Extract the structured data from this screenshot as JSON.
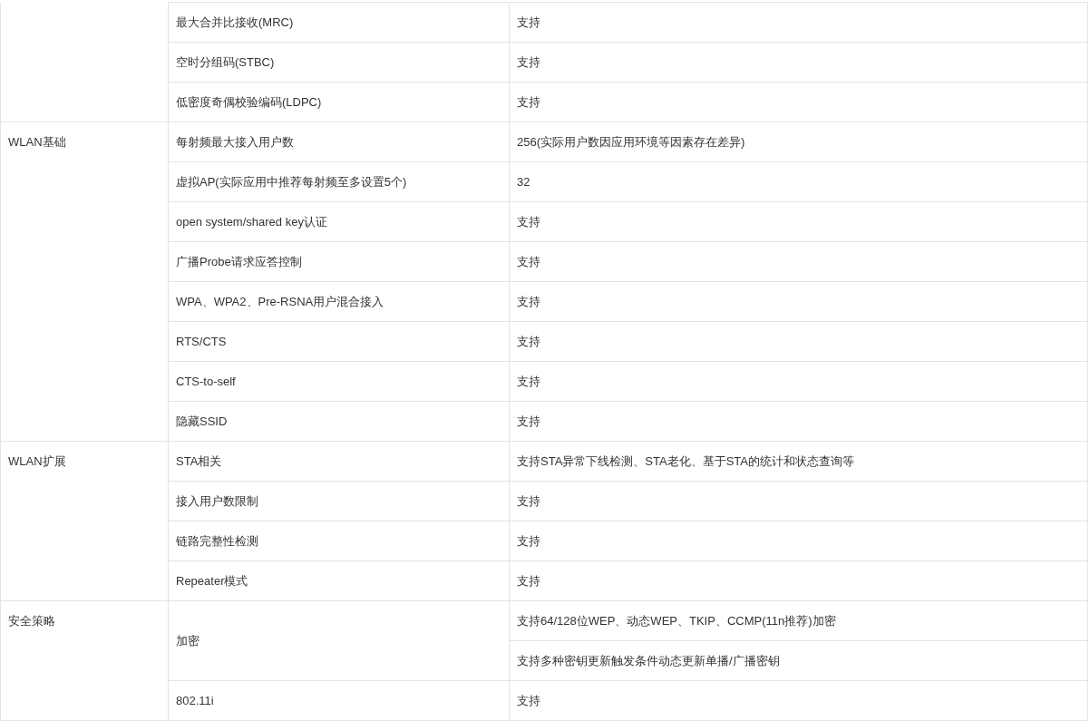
{
  "spec_table": {
    "groups": [
      {
        "rows": [
          {
            "feature": "最大合并比接收(MRC)",
            "values": [
              "支持"
            ]
          },
          {
            "feature": "空时分组码(STBC)",
            "values": [
              "支持"
            ]
          },
          {
            "feature": "低密度奇偶校验编码(LDPC)",
            "values": [
              "支持"
            ]
          }
        ]
      },
      {
        "label": "WLAN基础",
        "rows": [
          {
            "feature": "每射频最大接入用户数",
            "values": [
              "256(实际用户数因应用环境等因素存在差异)"
            ]
          },
          {
            "feature": "虚拟AP(实际应用中推荐每射频至多设置5个)",
            "values": [
              "32"
            ]
          },
          {
            "feature": "open system/shared key认证",
            "values": [
              "支持"
            ]
          },
          {
            "feature": "广播Probe请求应答控制",
            "values": [
              "支持"
            ]
          },
          {
            "feature": "WPA、WPA2、Pre-RSNA用户混合接入",
            "values": [
              "支持"
            ]
          },
          {
            "feature": "RTS/CTS",
            "values": [
              "支持"
            ]
          },
          {
            "feature": "CTS-to-self",
            "values": [
              "支持"
            ]
          },
          {
            "feature": "隐藏SSID",
            "values": [
              "支持"
            ]
          }
        ]
      },
      {
        "label": "WLAN扩展",
        "rows": [
          {
            "feature": "STA相关",
            "values": [
              "支持STA异常下线检测、STA老化、基于STA的统计和状态查询等"
            ]
          },
          {
            "feature": "接入用户数限制",
            "values": [
              "支持"
            ]
          },
          {
            "feature": "链路完整性检测",
            "values": [
              "支持"
            ]
          },
          {
            "feature": "Repeater模式",
            "values": [
              "支持"
            ]
          }
        ]
      },
      {
        "label": "安全策略",
        "rows": [
          {
            "feature": "加密",
            "values": [
              "支持64/128位WEP、动态WEP、TKIP、CCMP(11n推荐)加密",
              "支持多种密钥更新触发条件动态更新单播/广播密钥"
            ]
          },
          {
            "feature": "802.11i",
            "values": [
              "支持"
            ]
          }
        ]
      }
    ]
  }
}
